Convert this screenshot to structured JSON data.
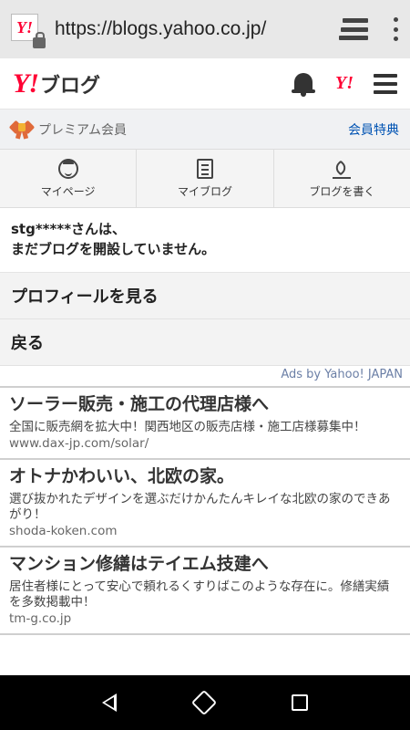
{
  "browser": {
    "url": "https://blogs.yahoo.co.jp/",
    "favicon_text": "Y!"
  },
  "header": {
    "logo_mark": "Y!",
    "logo_text": "ブログ",
    "yahoo_mark": "Y!"
  },
  "premium": {
    "label": "プレミアム会員",
    "benefits_link": "会員特典"
  },
  "nav": [
    {
      "label": "マイページ",
      "icon": "face-icon"
    },
    {
      "label": "マイブログ",
      "icon": "book-icon"
    },
    {
      "label": "ブログを書く",
      "icon": "pen-icon"
    }
  ],
  "message": {
    "line1": "stg*****さんは、",
    "line2": "まだブログを開設していません。"
  },
  "menu": {
    "profile": "プロフィールを見る",
    "back": "戻る"
  },
  "ads": {
    "label": "Ads by Yahoo! JAPAN",
    "items": [
      {
        "title": "ソーラー販売・施工の代理店様へ",
        "desc": "全国に販売網を拡大中！関西地区の販売店様・施工店様募集中！",
        "url": "www.dax-jp.com/solar/"
      },
      {
        "title": "オトナかわいい、北欧の家。",
        "desc": "選び抜かれたデザインを選ぶだけかんたんキレイな北欧の家のできあがり！",
        "url": "shoda-koken.com"
      },
      {
        "title": "マンション修繕はテイエム技建へ",
        "desc": "居住者様にとって安心で頼れるくすりばこのような存在に。修繕実績を多数掲載中！",
        "url": "tm-g.co.jp"
      }
    ]
  },
  "colors": {
    "yahoo_red": "#ff0033",
    "link_blue": "#0053b3"
  }
}
